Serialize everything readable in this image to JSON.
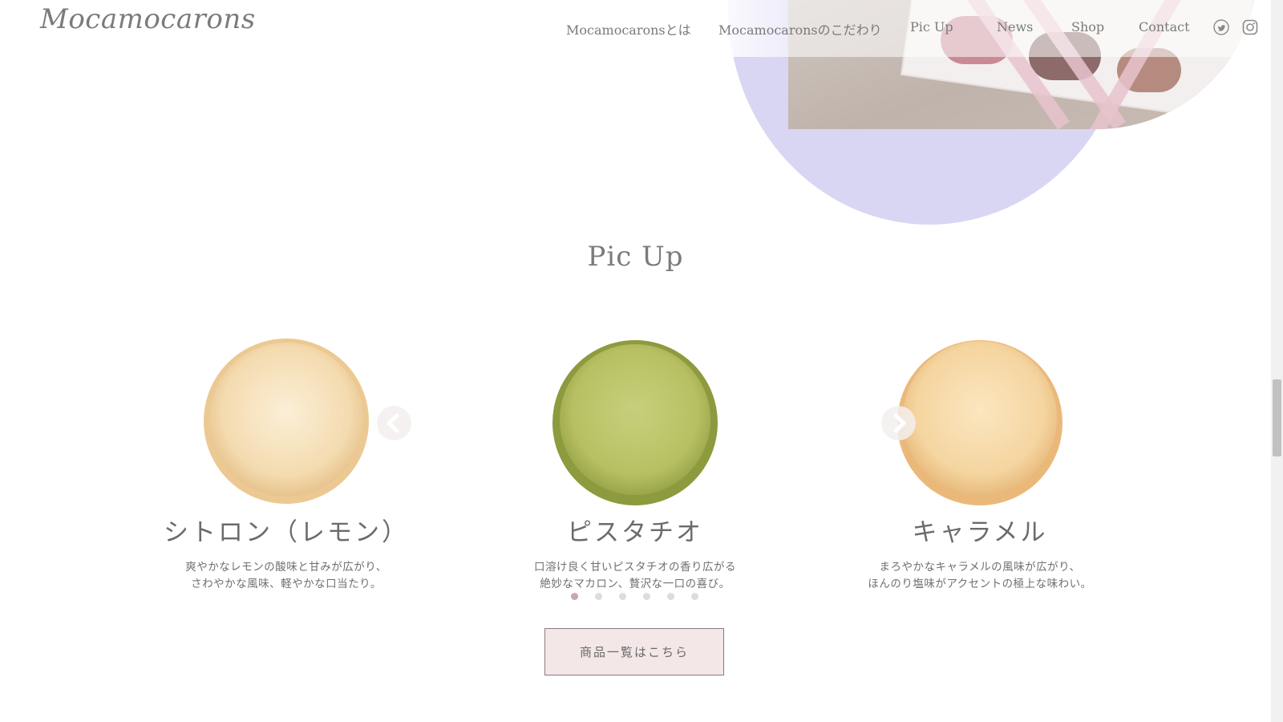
{
  "header": {
    "logo": "Mocamocarons",
    "nav": [
      {
        "label": "Mocamocaronsとは"
      },
      {
        "label": "Mocamocaronsのこだわり"
      },
      {
        "label": "Pic Up"
      },
      {
        "label": "News"
      },
      {
        "label": "Shop"
      },
      {
        "label": "Contact"
      }
    ],
    "social": [
      {
        "icon": "twitter-icon"
      },
      {
        "icon": "instagram-icon"
      }
    ]
  },
  "pickup": {
    "title": "Pic Up",
    "cards": [
      {
        "name": "シトロン（レモン）",
        "desc_line1": "爽やかなレモンの酸味と甘みが広がり、",
        "desc_line2": "さわやかな風味、軽やかな口当たり。",
        "color": "#f5ddb2"
      },
      {
        "name": "ピスタチオ",
        "desc_line1": "口溶け良く甘いピスタチオの香り広がる",
        "desc_line2": "絶妙なマカロン、贅沢な一口の喜び。",
        "color": "#bcc46a"
      },
      {
        "name": "キャラメル",
        "desc_line1": "まろやかなキャラメルの風味が広がり、",
        "desc_line2": "ほんのり塩味がアクセントの極上な味わい。",
        "color": "#f6d7a6"
      }
    ],
    "prev_icon": "chevron-left-icon",
    "next_icon": "chevron-right-icon",
    "dots_count": 6,
    "active_dot": 0,
    "button_label": "商品一覧はこちら"
  },
  "colors": {
    "blob": "#d9d6f4",
    "button_bg": "#f3e7e7",
    "active_dot": "#c7a7ae"
  }
}
